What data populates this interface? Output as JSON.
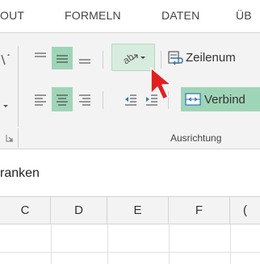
{
  "ribbon_tabs": [
    "OUT",
    "FORMELN",
    "DATEN",
    "ÜB"
  ],
  "ribbon": {
    "wrap_text_label": "Zeilenum",
    "merge_label": "Verbind",
    "group_label": "Ausrichtung"
  },
  "name_box": {
    "value": "ranken"
  },
  "columns": [
    "C",
    "D",
    "E",
    "F",
    "("
  ],
  "colors": {
    "accent_selected": "#9fd5b7",
    "hover": "#d7ecdf",
    "cursor_red": "#e02020"
  }
}
